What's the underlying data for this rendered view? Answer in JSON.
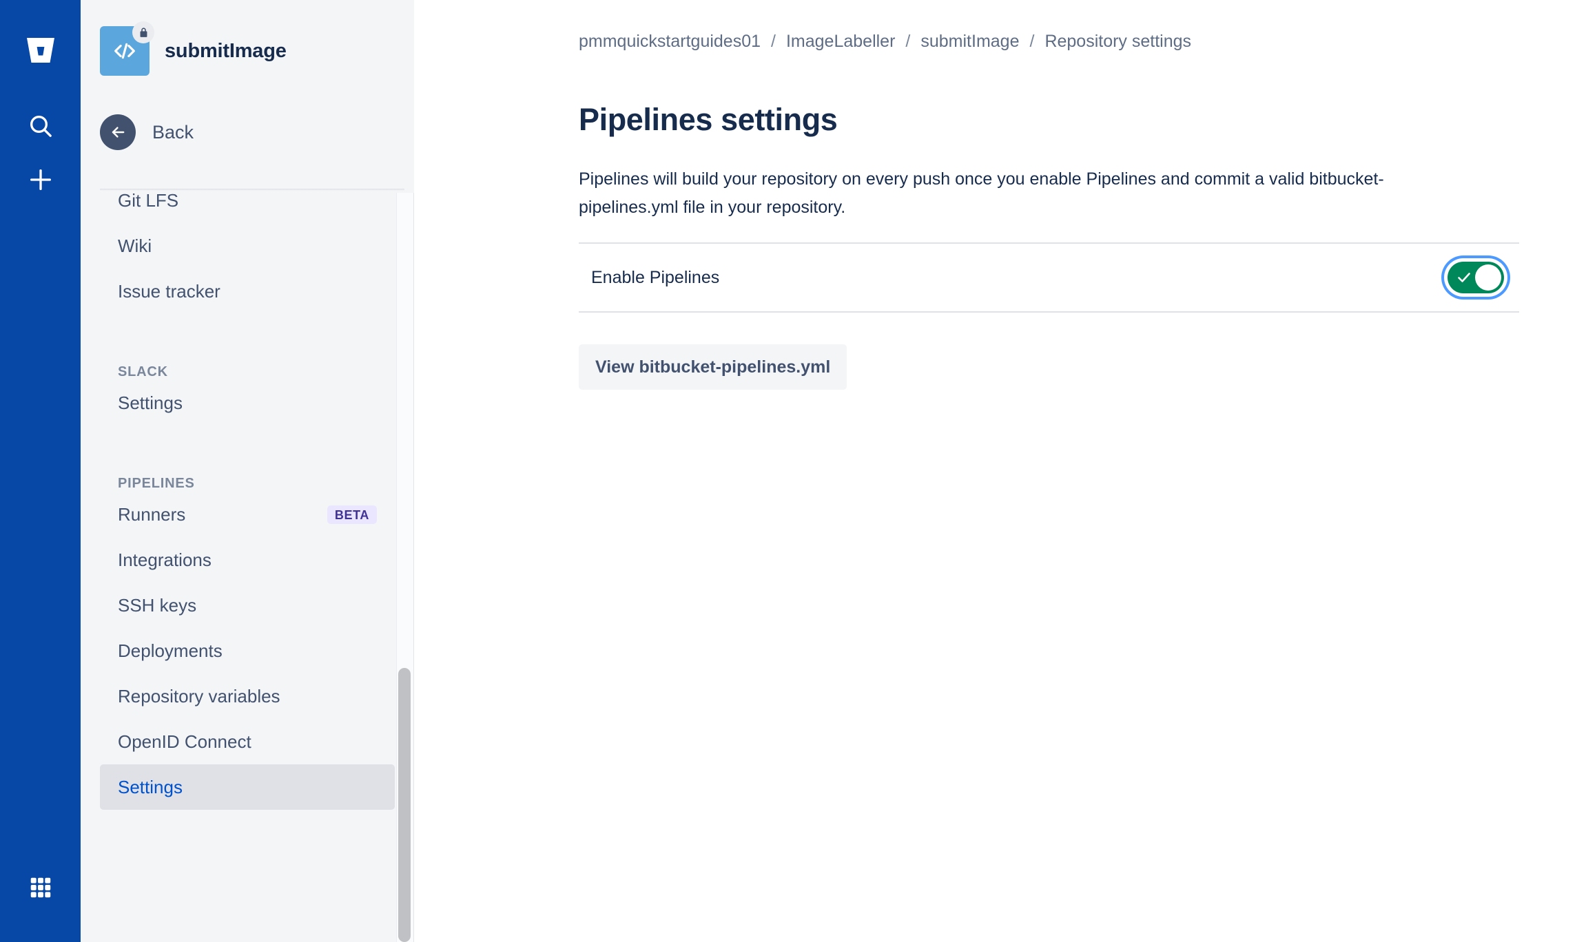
{
  "colors": {
    "rail_blue": "#0747A6",
    "sidebar_bg": "#F4F5F7",
    "link_blue": "#0052CC",
    "text_navy": "#172B4D",
    "text_subtle": "#5E6C84",
    "toggle_green": "#00875A",
    "focus_ring": "#4C9AFF",
    "beta_bg": "#EAE6FF",
    "beta_text": "#403294",
    "avatar_blue": "#5BA7DD"
  },
  "rail": {
    "logo_icon": "bitbucket-logo-icon",
    "items": [
      {
        "icon": "search-icon",
        "name": "rail-search"
      },
      {
        "icon": "plus-icon",
        "name": "rail-create"
      },
      {
        "icon": "app-switcher-grid-icon",
        "name": "rail-app-switcher"
      }
    ]
  },
  "sidebar": {
    "repo_name": "submitImage",
    "repo_avatar_icon": "code-brackets-icon",
    "repo_lock_icon": "lock-icon",
    "back_label": "Back",
    "back_icon": "arrow-left-icon",
    "nav": [
      {
        "type": "item",
        "label": "Git LFS",
        "selected": false,
        "clipped": true
      },
      {
        "type": "item",
        "label": "Wiki",
        "selected": false
      },
      {
        "type": "item",
        "label": "Issue tracker",
        "selected": false
      },
      {
        "type": "spacer"
      },
      {
        "type": "section",
        "label": "SLACK"
      },
      {
        "type": "item",
        "label": "Settings",
        "selected": false
      },
      {
        "type": "spacer"
      },
      {
        "type": "section",
        "label": "PIPELINES"
      },
      {
        "type": "item",
        "label": "Runners",
        "selected": false,
        "badge": "BETA"
      },
      {
        "type": "item",
        "label": "Integrations",
        "selected": false
      },
      {
        "type": "item",
        "label": "SSH keys",
        "selected": false
      },
      {
        "type": "item",
        "label": "Deployments",
        "selected": false
      },
      {
        "type": "item",
        "label": "Repository variables",
        "selected": false
      },
      {
        "type": "item",
        "label": "OpenID Connect",
        "selected": false
      },
      {
        "type": "item",
        "label": "Settings",
        "selected": true
      }
    ]
  },
  "main": {
    "breadcrumb": [
      "pmmquickstartguides01",
      "ImageLabeller",
      "submitImage",
      "Repository settings"
    ],
    "breadcrumb_separator": "/",
    "title": "Pipelines settings",
    "description": "Pipelines will build your repository on every push once you enable Pipelines and commit a valid bitbucket-pipelines.yml file in your repository.",
    "setting": {
      "label": "Enable Pipelines",
      "toggle_state": "on",
      "toggle_icon": "checkmark-icon"
    },
    "view_yml_label": "View bitbucket-pipelines.yml"
  }
}
